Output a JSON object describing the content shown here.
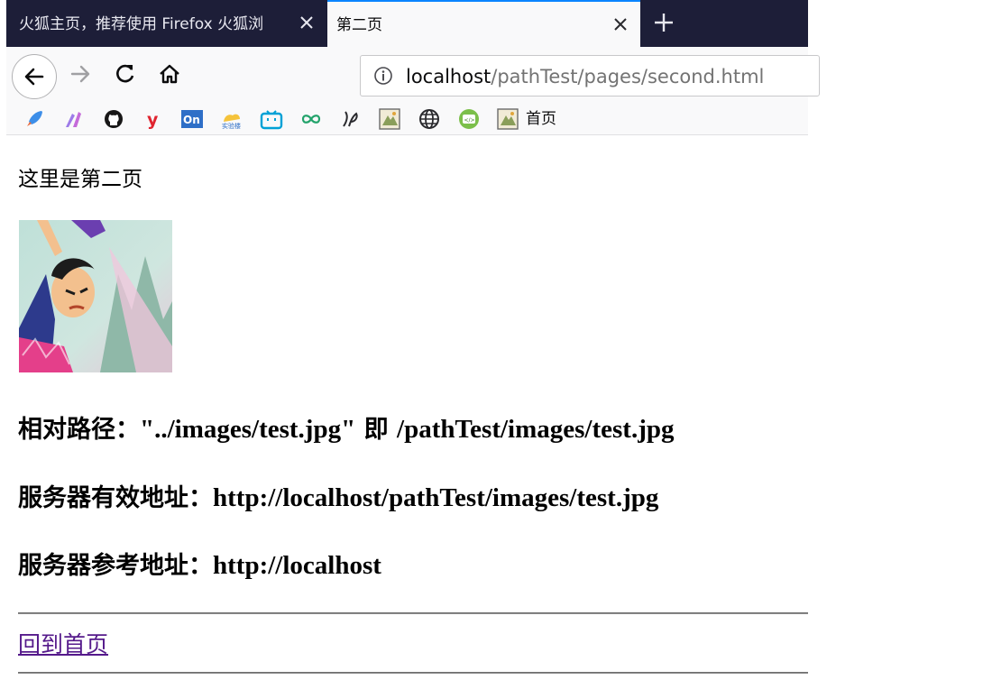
{
  "tabs": [
    {
      "title": "火狐主页，推荐使用 Firefox 火狐浏",
      "active": false
    },
    {
      "title": "第二页",
      "active": true
    }
  ],
  "urlbar": {
    "host": "localhost",
    "path": "/pathTest/pages/second.html"
  },
  "bookmarks": {
    "icons": [
      "rocket-icon",
      "brush-icon",
      "github-icon",
      "y-icon",
      "on-icon",
      "labs-icon",
      "bilibili-icon",
      "infinity-icon",
      "script-icon",
      "image-icon",
      "globe-icon",
      "code-icon",
      "image-icon"
    ],
    "last_label": "首页"
  },
  "page": {
    "intro": "这里是第二页",
    "relative_label": "相对路径：",
    "relative_value": "\"../images/test.jpg\"",
    "relative_mid": " 即 ",
    "relative_result": "/pathTest/images/test.jpg",
    "server_label": "服务器有效地址：",
    "server_value": "http://localhost/pathTest/images/test.jpg",
    "ref_label": "服务器参考地址：",
    "ref_value": "http://localhost",
    "back_link": "回到首页"
  },
  "colors": {
    "tabbar": "#1d1e38",
    "accent": "#0a84ff",
    "link_visited": "#551a8b"
  }
}
